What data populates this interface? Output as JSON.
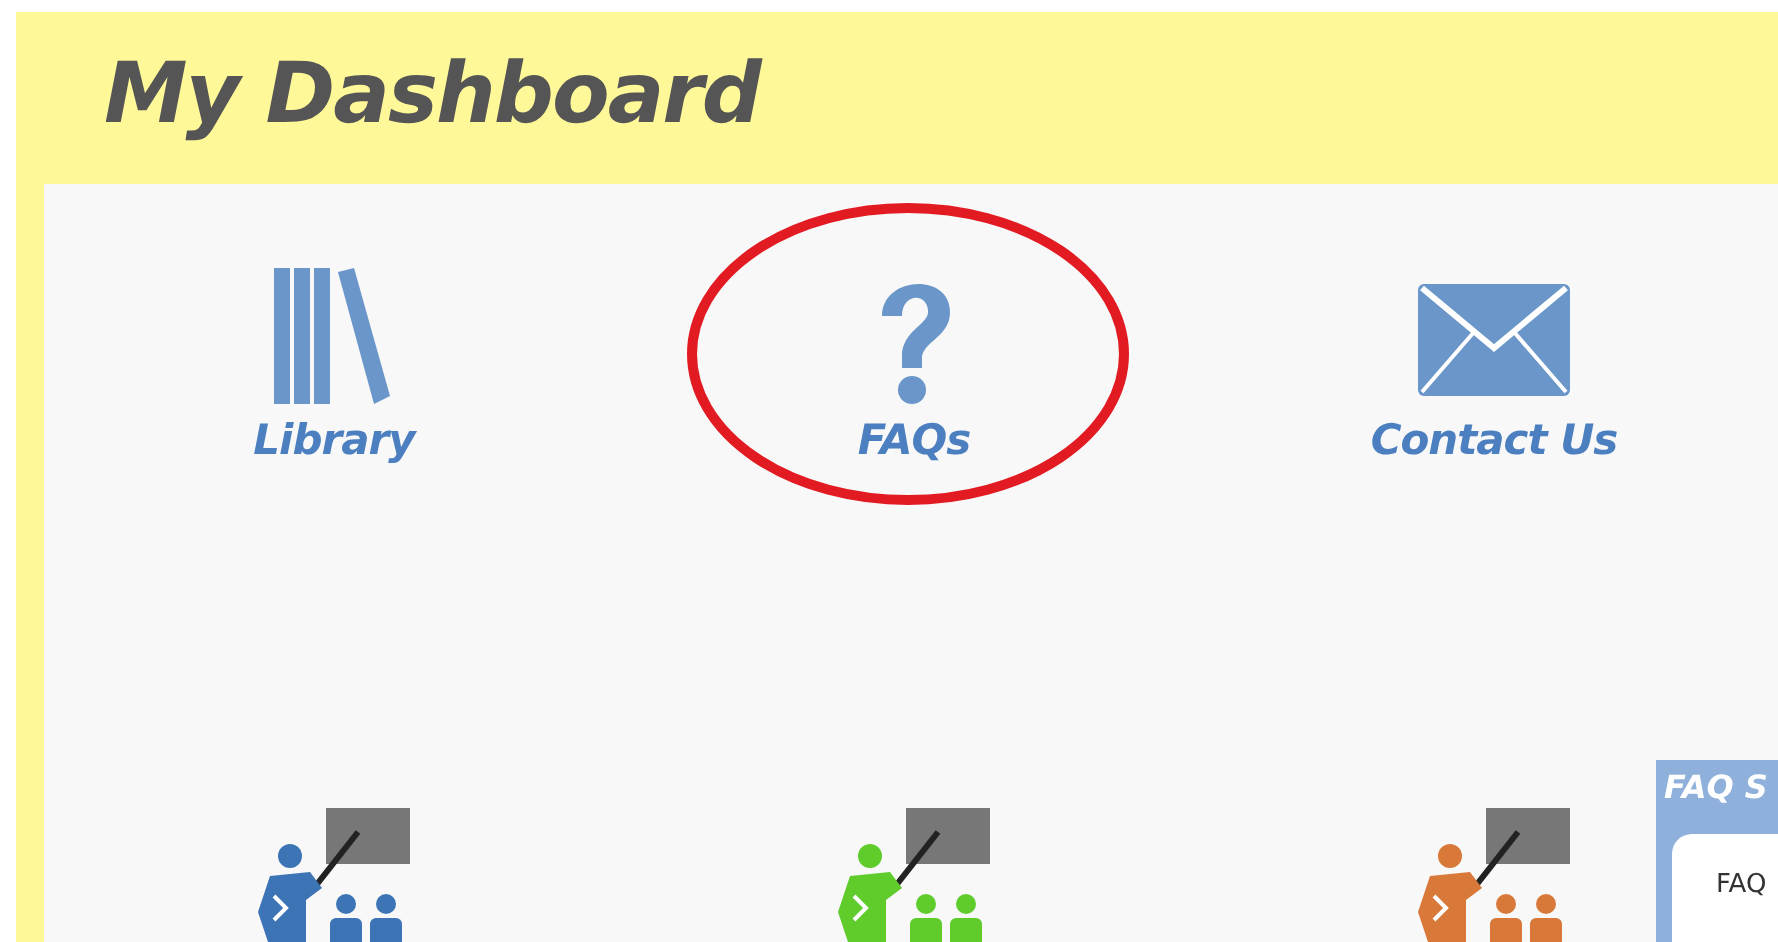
{
  "title": "My Dashboard",
  "tiles": [
    {
      "kind": "library",
      "label": "Library",
      "highlighted": false
    },
    {
      "kind": "faq",
      "label": "FAQs",
      "highlighted": true
    },
    {
      "kind": "contact",
      "label": "Contact Us",
      "highlighted": false
    }
  ],
  "training_tiles": [
    {
      "color": "#3d74b6"
    },
    {
      "color": "#5fcc2c"
    },
    {
      "color": "#d8793a"
    }
  ],
  "faq_panel": {
    "title": "FAQ S",
    "body": "FAQ"
  }
}
